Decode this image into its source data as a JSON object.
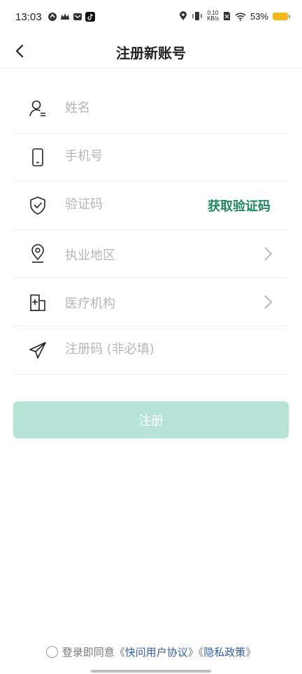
{
  "status_bar": {
    "time": "13:03",
    "speed_value": "0.10",
    "speed_unit": "KB/s",
    "battery_pct": "53%",
    "battery_level": 0.53,
    "battery_color": "#f3b71c"
  },
  "nav": {
    "title": "注册新账号"
  },
  "form": {
    "name_placeholder": "姓名",
    "phone_placeholder": "手机号",
    "code_placeholder": "验证码",
    "get_code_label": "获取验证码",
    "region_label": "执业地区",
    "org_label": "医疗机构",
    "reg_code_placeholder": "注册码 (非必填)"
  },
  "register_button": {
    "label": "注册",
    "color": "#b7e2d6"
  },
  "agreement": {
    "prefix": "登录即同意《",
    "user_agreement": "快问用户协议",
    "middle": "》《",
    "privacy_policy": "隐私政策",
    "suffix": "》"
  },
  "colors": {
    "accent": "#1e8a5c",
    "link": "#2f5fa8"
  }
}
